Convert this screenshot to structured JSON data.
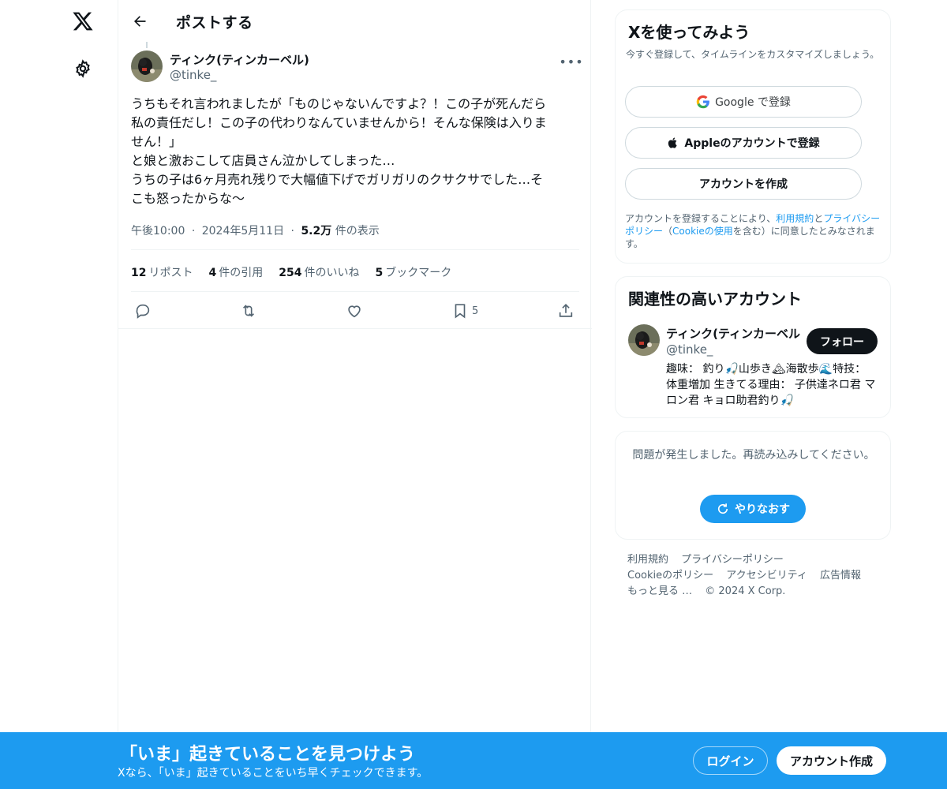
{
  "nav": {
    "logo_icon": "x-logo-icon",
    "settings_icon": "gear-icon"
  },
  "header": {
    "title": "ポストする"
  },
  "post": {
    "author_name": "ティンク(ティンカーベル)",
    "author_handle": "@tinke_",
    "text": "うちもそれ言われましたが「ものじゃないんですよ？！この子が死んだら\n私の責任だし！この子の代わりなんていませんから！そんな保険は入りま\nせん！」\nと娘と激おこして店員さん泣かしてしまった…\nうちの子は6ヶ月売れ残りで大幅値下げでガリガリのクサクサでした…そ\nこも怒ったからな〜",
    "time": "午後10:00",
    "date": "2024年5月11日",
    "views_count": "5.2万",
    "views_label": "件の表示",
    "separator": "·",
    "stats": {
      "reposts_count": "12",
      "reposts_label": "リポスト",
      "quotes_count": "4",
      "quotes_label": "件の引用",
      "likes_count": "254",
      "likes_label": "件のいいね",
      "bookmarks_count": "5",
      "bookmarks_label": "ブックマーク"
    },
    "action_bookmark_count": "5"
  },
  "signup_card": {
    "title": "Xを使ってみよう",
    "subtitle": "今すぐ登録して、タイムラインをカスタマイズしましょう。",
    "google_label": "Google で登録",
    "apple_label": "Appleのアカウントで登録",
    "create_label": "アカウントを作成",
    "legal_prefix": "アカウントを登録することにより、",
    "terms_link": "利用規約",
    "legal_and": "と",
    "privacy_link": "プライバシーポリシー",
    "legal_paren_open": "（",
    "cookie_link": "Cookieの使用",
    "legal_suffix": "を含む）に同意したとみなされます。"
  },
  "related_card": {
    "title": "関連性の高いアカウント",
    "name": "ティンク(ティンカーベル",
    "handle": "@tinke_",
    "follow_label": "フォロー",
    "bio": "趣味： 釣り🎣山歩き🏔海散歩🌊特技： 体重増加 生きてる理由： 子供達ネロ君 マロン君 キョロ助君釣り🎣"
  },
  "error_card": {
    "message": "問題が発生しました。再読み込みしてください。",
    "retry_label": "やりなおす"
  },
  "footer": {
    "terms": "利用規約",
    "privacy": "プライバシーポリシー",
    "cookie": "Cookieのポリシー",
    "accessibility": "アクセシビリティ",
    "ads": "広告情報",
    "more": "もっと見る …",
    "copyright": "© 2024 X Corp."
  },
  "banner": {
    "title": "「いま」起きていることを見つけよう",
    "subtitle": "Xなら、「いま」起きていることをいち早くチェックできます。",
    "login_label": "ログイン",
    "signup_label": "アカウント作成"
  },
  "colors": {
    "accent": "#1d9bf0",
    "text": "#0f1419",
    "muted": "#536471",
    "border": "#eff3f4"
  }
}
